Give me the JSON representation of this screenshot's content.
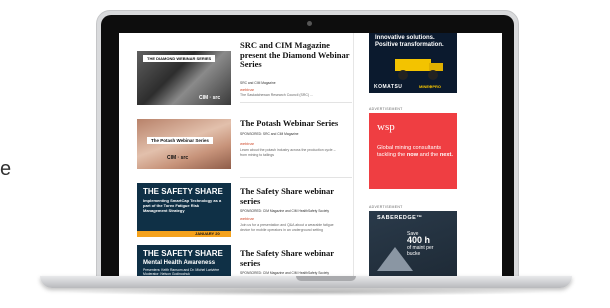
{
  "edge_text": "e",
  "feed": {
    "items": [
      {
        "thumb_header": "THE DIAMOND WEBINAR SERIES",
        "thumb_logos": "CIM · src",
        "title": "SRC and CIM Magazine present the Diamond Webinar Series",
        "meta": "SRC and CIM Magazine",
        "tag": "webinar",
        "desc": "The Saskatchewan Research Council (SRC) ..."
      },
      {
        "thumb_header": "The Potash Webinar Series",
        "thumb_logos": "CIM · src",
        "title": "The Potash Webinar Series",
        "meta": "SPONSORED: SRC and CIM Magazine",
        "tag": "webinar",
        "desc": "Learn about the potash industry across the production cycle – from mining to tailings"
      },
      {
        "thumb_header": "THE SAFETY SHARE",
        "thumb_sub": "Implementing SmartCap Technology as a part of the Torex Fatigue Risk Management Strategy",
        "thumb_date": "JANUARY 20",
        "title": "The Safety Share webinar series",
        "meta": "SPONSORED: CIM Magazine and CIM HealthSafety Society",
        "tag": "webinar",
        "desc": "Join us for a presentation and Q&A about a wearable fatigue device for mobile operators in an underground setting"
      },
      {
        "thumb_header": "THE SAFETY SHARE",
        "thumb_sub": "Mental Health Awareness",
        "thumb_sub2": "Presenters: Keith Ransom and Dr. Michel Larivière Moderator: Nelson Godinochuk",
        "title": "The Safety Share webinar series",
        "meta": "SPONSORED: CIM Magazine and CIM HealthSafety Society",
        "tag": "webinar"
      }
    ]
  },
  "sidebar": {
    "ad1": {
      "line1": "Innovative solutions.",
      "line2": "Positive transformation.",
      "brand": "KOMATSU",
      "brand2": "MINE⊕PRO"
    },
    "ad_label_2": "ADVERTISEMENT",
    "ad2": {
      "logo": "wsp",
      "copy_pre": "Global mining consultants tackling the ",
      "copy_now": "now",
      "copy_mid": " and the ",
      "copy_next": "next."
    },
    "ad_label_3": "ADVERTISEMENT",
    "ad3": {
      "logo": "SABEREDGE™",
      "save": "Save",
      "hours": "400 h",
      "rest": "of maint per bucke"
    }
  },
  "colors": {
    "accent_red": "#ef3e42",
    "tag_red": "#d04a2c",
    "navy": "#0f3046",
    "orange": "#f4a21d"
  }
}
